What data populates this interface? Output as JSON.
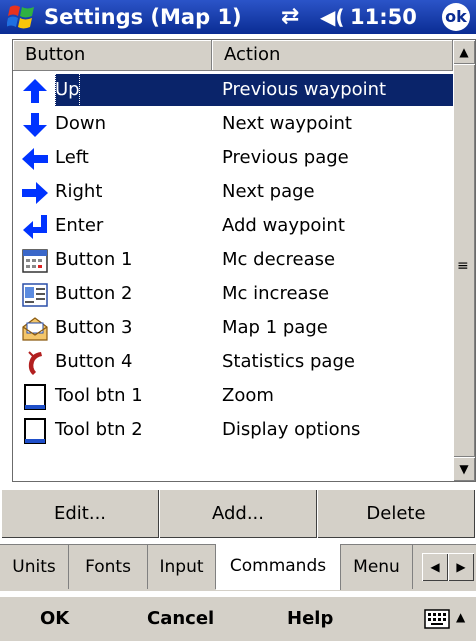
{
  "window": {
    "title": "Settings (Map 1)",
    "time": "11:50",
    "ok_label": "ok"
  },
  "list": {
    "columns": [
      "Button",
      "Action"
    ],
    "rows": [
      {
        "button": "Up",
        "action": "Previous waypoint",
        "icon": "arrow-up-icon",
        "selected": true
      },
      {
        "button": "Down",
        "action": "Next waypoint",
        "icon": "arrow-down-icon"
      },
      {
        "button": "Left",
        "action": "Previous page",
        "icon": "arrow-left-icon"
      },
      {
        "button": "Right",
        "action": "Next page",
        "icon": "arrow-right-icon"
      },
      {
        "button": "Enter",
        "action": "Add waypoint",
        "icon": "enter-icon"
      },
      {
        "button": "Button 1",
        "action": "Mc decrease",
        "icon": "calendar-icon"
      },
      {
        "button": "Button 2",
        "action": "Mc increase",
        "icon": "contacts-icon"
      },
      {
        "button": "Button 3",
        "action": "Map 1 page",
        "icon": "inbox-icon"
      },
      {
        "button": "Button 4",
        "action": "Statistics page",
        "icon": "phone-icon"
      },
      {
        "button": "Tool btn 1",
        "action": "Zoom",
        "icon": "tool-button-icon"
      },
      {
        "button": "Tool btn 2",
        "action": "Display options",
        "icon": "tool-button-icon"
      }
    ]
  },
  "commands": {
    "edit": "Edit...",
    "add": "Add...",
    "delete": "Delete"
  },
  "tabs": [
    {
      "label": "Units"
    },
    {
      "label": "Fonts"
    },
    {
      "label": "Input"
    },
    {
      "label": "Commands",
      "active": true
    },
    {
      "label": "Menu"
    }
  ],
  "menubar": {
    "ok": "OK",
    "cancel": "Cancel",
    "help": "Help"
  },
  "colors": {
    "titlebar": "#0a2c93",
    "selection": "#0a246a",
    "arrow_blue": "#0033ff",
    "chrome": "#d4d0c8"
  }
}
